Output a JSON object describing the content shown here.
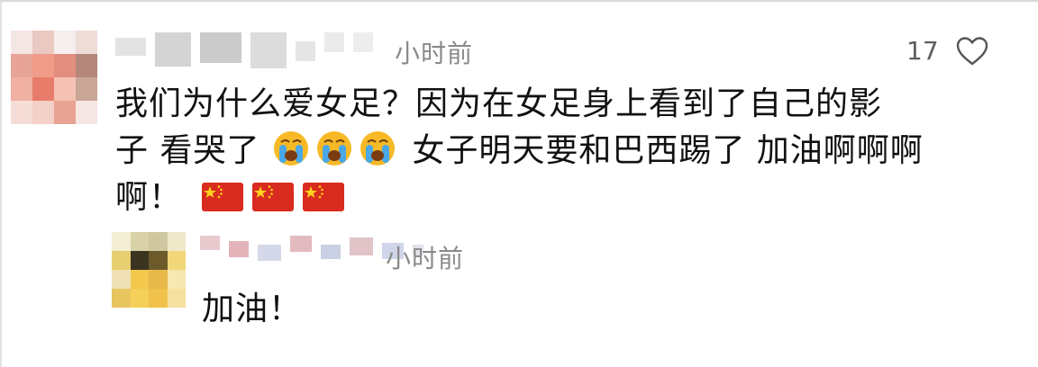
{
  "comment": {
    "time": "小时前",
    "likes": "17",
    "line1": "我们为什么爱女足？因为在女足身上看到了自己的影",
    "line2_a": "子 看哭了",
    "line2_b": " 女子明天要和巴西踢了 加油啊啊啊",
    "line3": "啊！",
    "icons": {
      "like": "heart-outline-icon",
      "crying_emoji": "loudly-crying-face-emoji",
      "flag_emoji": "china-flag-emoji"
    },
    "crying_emoji_count": 3,
    "flag_emoji_count": 3
  },
  "reply": {
    "time": "小时前",
    "text": "加油！"
  },
  "colors": {
    "time_gray": "#8a8a8a",
    "text": "#111111",
    "flag_red": "#d92b1f",
    "flag_star": "#ffd21f",
    "emoji_yellow": "#f7b926",
    "tears_blue": "#4aa8e8"
  }
}
